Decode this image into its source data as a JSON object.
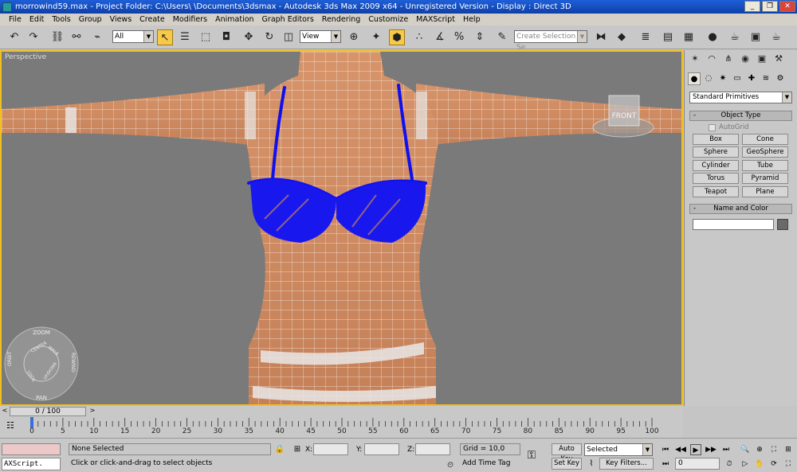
{
  "titlebar": {
    "title": "morrowind59.max   - Project Folder: C:\\Users\\             \\Documents\\3dsmax   - Autodesk 3ds Max  2009 x64   - Unregistered Version     - Display : Direct 3D"
  },
  "menu": [
    "File",
    "Edit",
    "Tools",
    "Group",
    "Views",
    "Create",
    "Modifiers",
    "Animation",
    "Graph Editors",
    "Rendering",
    "Customize",
    "MAXScript",
    "Help"
  ],
  "toolbar": {
    "selection_filter": "All",
    "ref_coord": "View",
    "named_selection_placeholder": "Create Selection Se"
  },
  "viewport": {
    "label": "Perspective",
    "viewcube_face": "FRONT",
    "wheel": {
      "zoom": "ZOOM",
      "orbit": "ORBIT",
      "rewind": "REWIND",
      "pan": "PAN",
      "center": "CENTER",
      "walk": "WALK",
      "look": "LOOK",
      "updown": "UP/DOWN"
    }
  },
  "command_panel": {
    "category": "Standard Primitives",
    "object_type_title": "Object Type",
    "autogrid": "AutoGrid",
    "primitives": [
      "Box",
      "Cone",
      "Sphere",
      "GeoSphere",
      "Cylinder",
      "Tube",
      "Torus",
      "Pyramid",
      "Teapot",
      "Plane"
    ],
    "name_color_title": "Name and Color"
  },
  "timeline": {
    "frame_display": "0 / 100",
    "ticks": [
      "0",
      "5",
      "10",
      "15",
      "20",
      "25",
      "30",
      "35",
      "40",
      "45",
      "50",
      "55",
      "60",
      "65",
      "70",
      "75",
      "80",
      "85",
      "90",
      "95",
      "100"
    ]
  },
  "status": {
    "maxscript_listener": "AXScript.",
    "selection_status": "None Selected",
    "prompt": "Click or click-and-drag to select objects",
    "x_label": "X:",
    "y_label": "Y:",
    "z_label": "Z:",
    "grid": "Grid = 10,0",
    "add_time_tag": "Add Time Tag",
    "auto_key": "Auto Key",
    "set_key": "Set Key",
    "key_mode": "Selected",
    "key_filters": "Key Filters...",
    "frame": "0"
  }
}
